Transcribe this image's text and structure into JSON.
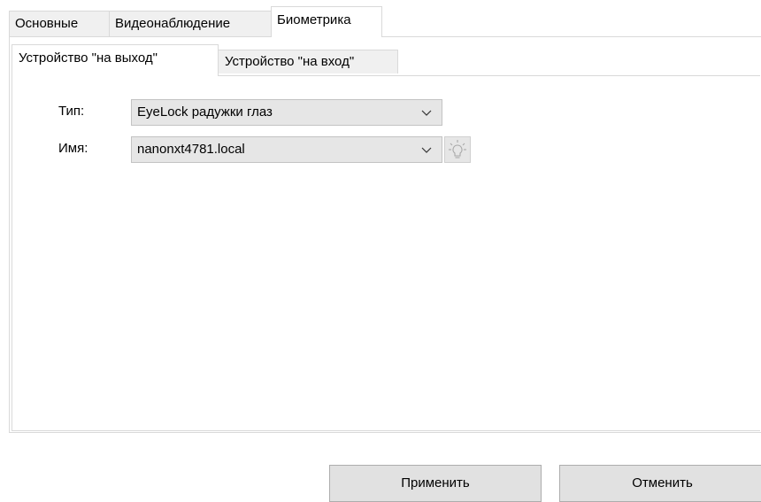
{
  "outer_tabs": [
    {
      "label": "Основные"
    },
    {
      "label": "Видеонаблюдение"
    },
    {
      "label": "Биометрика"
    }
  ],
  "outer_active": "Биометрика",
  "inner_tabs": [
    {
      "label": "Устройство \"на выход\""
    },
    {
      "label": "Устройство \"на вход\""
    }
  ],
  "inner_active": "Устройство \"на выход\"",
  "form": {
    "type_label": "Тип:",
    "type_value": "EyeLock радужки глаз",
    "name_label": "Имя:",
    "name_value": "nanonxt4781.local"
  },
  "icons": {
    "dropdown": "chevron-down-icon",
    "identify": "lightbulb-icon"
  },
  "buttons": {
    "apply": "Применить",
    "cancel": "Отменить"
  }
}
